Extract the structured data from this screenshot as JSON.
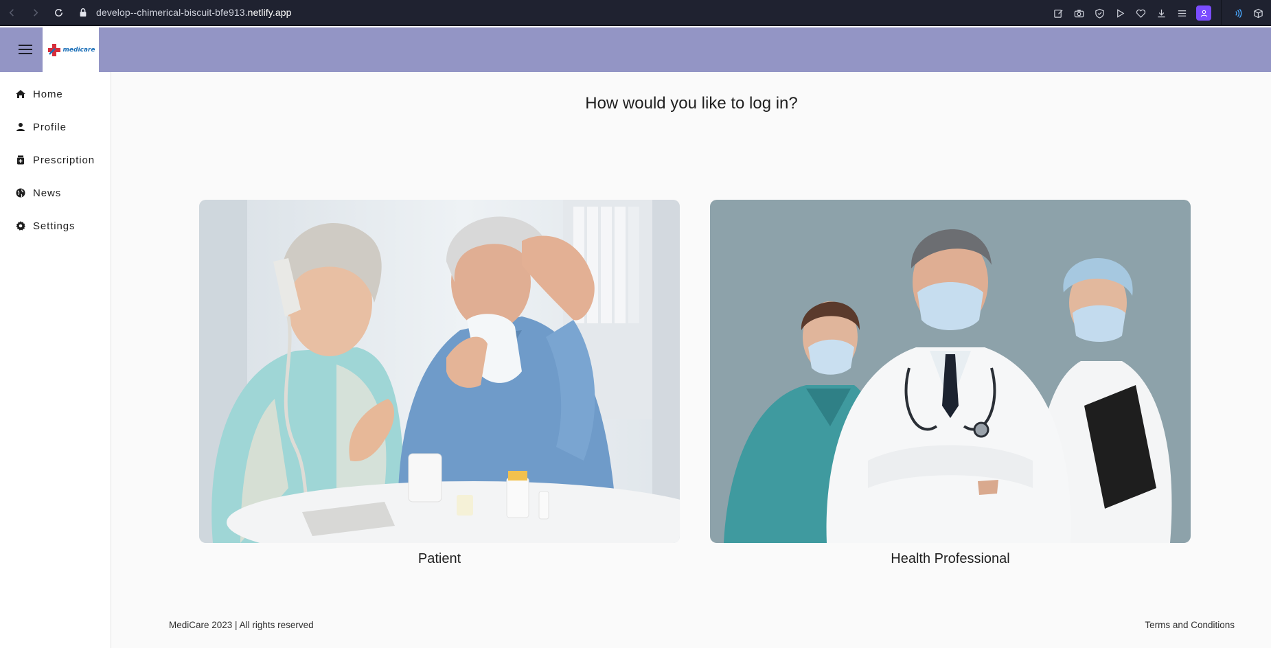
{
  "browser": {
    "url_prefix": "develop--chimerical-biscuit-bfe913.",
    "url_domain": "netlify.app"
  },
  "header": {
    "logo_text": "medicare"
  },
  "sidebar": {
    "items": [
      {
        "label": "Home",
        "icon": "home-icon"
      },
      {
        "label": "Profile",
        "icon": "person-icon"
      },
      {
        "label": "Prescription",
        "icon": "pill-bottle-icon"
      },
      {
        "label": "News",
        "icon": "globe-icon"
      },
      {
        "label": "Settings",
        "icon": "gear-icon"
      }
    ]
  },
  "main": {
    "heading": "How would you like to log in?",
    "cards": [
      {
        "label": "Patient",
        "image": "elderly-couple-photo"
      },
      {
        "label": "Health Professional",
        "image": "medical-team-photo"
      }
    ]
  },
  "footer": {
    "copyright": "MediCare 2023 | All rights reserved",
    "terms": "Terms and Conditions"
  },
  "colors": {
    "header_bg": "#9395c5",
    "browser_bg": "#1f2230",
    "page_bg": "#fafafa",
    "profile_accent": "#7b4dff"
  }
}
